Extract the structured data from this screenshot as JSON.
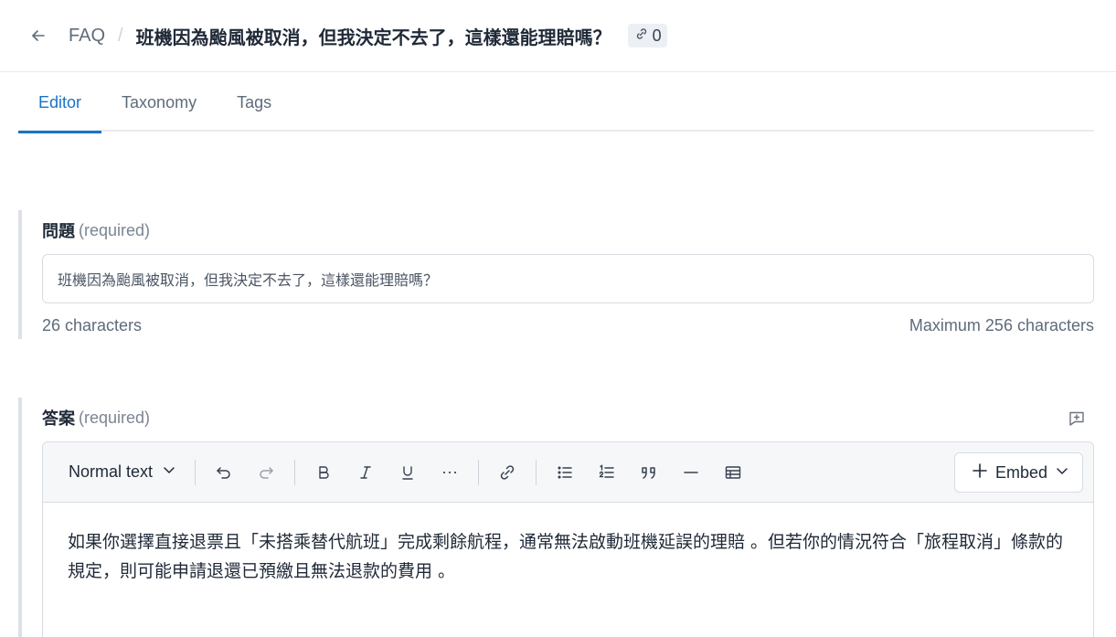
{
  "header": {
    "breadcrumb": "FAQ",
    "separator": "/",
    "title": "班機因為颱風被取消，但我決定不去了，這樣還能理賠嗎？",
    "link_count": "0"
  },
  "tabs": [
    {
      "label": "Editor",
      "active": true
    },
    {
      "label": "Taxonomy",
      "active": false
    },
    {
      "label": "Tags",
      "active": false
    }
  ],
  "question": {
    "label": "問題",
    "required": "(required)",
    "value": "班機因為颱風被取消，但我決定不去了，這樣還能理賠嗎？",
    "char_count": "26 characters",
    "max_chars": "Maximum 256 characters"
  },
  "answer": {
    "label": "答案",
    "required": "(required)",
    "content": "如果你選擇直接退票且「未搭乘替代航班」完成剩餘航程，通常無法啟動班機延誤的理賠 。但若你的情況符合「旅程取消」條款的規定，則可能申請退還已預繳且無法退款的費用 。"
  },
  "toolbar": {
    "text_style": "Normal text",
    "more": "···",
    "embed_label": "Embed"
  },
  "colors": {
    "accent": "#1a73c6",
    "border": "#d8dce1",
    "muted": "#5f6b7a"
  }
}
